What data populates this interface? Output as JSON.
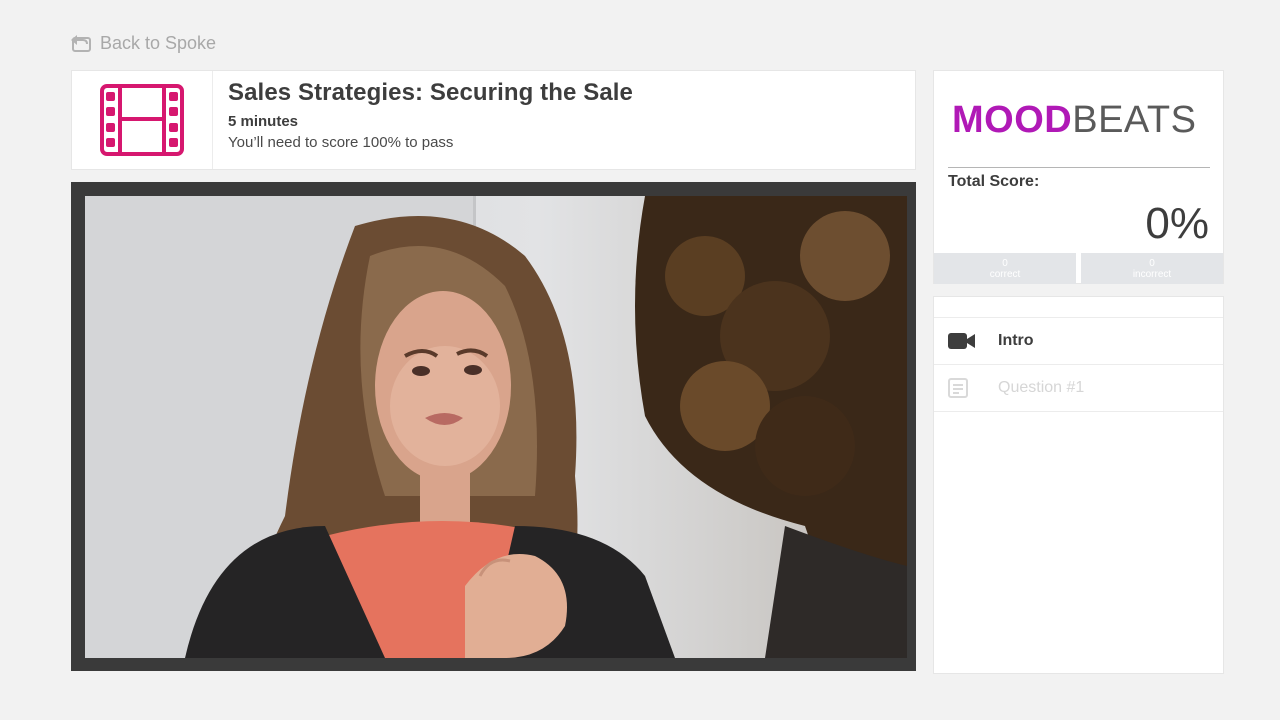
{
  "nav": {
    "back_label": "Back to Spoke",
    "back_icon": "back-arrow-icon"
  },
  "course": {
    "icon": "film-strip-icon",
    "icon_color": "#d6176f",
    "title": "Sales Strategies: Securing the Sale",
    "duration": "5 minutes",
    "pass_requirement": "You’ll need to score 100% to pass"
  },
  "brand": {
    "logo_bold": "MOOD",
    "logo_light": "BEATS",
    "logo_color": "#b019b6"
  },
  "score": {
    "label": "Total Score:",
    "value": "0%",
    "correct_count": "0",
    "correct_label": "correct",
    "incorrect_count": "0",
    "incorrect_label": "incorrect"
  },
  "chapters": [
    {
      "label": "Intro",
      "icon": "video-camera-icon",
      "state": "active"
    },
    {
      "label": "Question #1",
      "icon": "checklist-icon",
      "state": "locked"
    }
  ]
}
